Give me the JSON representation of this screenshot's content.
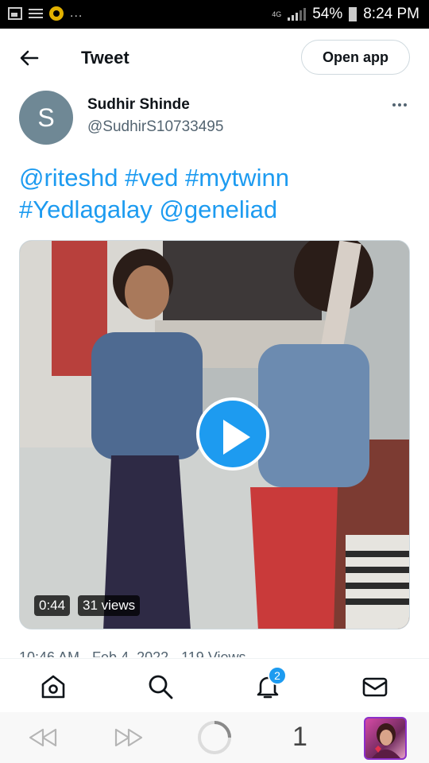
{
  "status_bar": {
    "network": "4G",
    "battery": "54%",
    "time": "8:24 PM",
    "notification_more": "..."
  },
  "header": {
    "title": "Tweet",
    "open_app_label": "Open app"
  },
  "tweet": {
    "avatar_letter": "S",
    "author_name": "Sudhir Shinde",
    "author_handle": "@SudhirS10733495",
    "text_parts": [
      "@riteshd",
      "#ved",
      "#mytwinn",
      "#Yedlagalay",
      "@geneliad"
    ],
    "video": {
      "duration": "0:44",
      "views": "31 views"
    },
    "meta_line": "10:46 AM · Feb 4, 2022 · 119 Views"
  },
  "bottom_nav": {
    "notification_count": "2"
  },
  "browser": {
    "tab_count": "1"
  },
  "colors": {
    "accent": "#1d9bf0",
    "text_primary": "#0f1419",
    "text_secondary": "#536471",
    "avatar_bg": "#6f8895"
  }
}
